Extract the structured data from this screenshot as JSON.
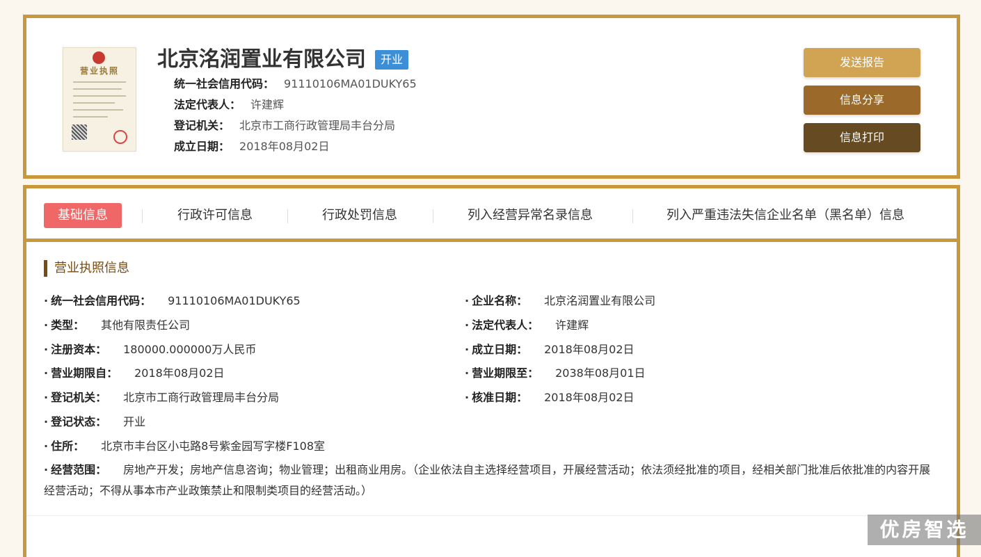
{
  "header": {
    "company_name": "北京洺润置业有限公司",
    "status_tag": "开业",
    "license_thumb_title": "营业执照",
    "credit_code_label": "统一社会信用代码：",
    "credit_code": "91110106MA01DUKY65",
    "legal_rep_label": "法定代表人：",
    "legal_rep": "许建辉",
    "authority_label": "登记机关：",
    "authority": "北京市工商行政管理局丰台分局",
    "founded_label": "成立日期：",
    "founded": "2018年08月02日"
  },
  "actions": {
    "report": "发送报告",
    "share": "信息分享",
    "print": "信息打印"
  },
  "tabs": [
    {
      "label": "基础信息",
      "active": true
    },
    {
      "label": "行政许可信息",
      "active": false
    },
    {
      "label": "行政处罚信息",
      "active": false
    },
    {
      "label": "列入经营异常名录信息",
      "active": false
    },
    {
      "label": "列入严重违法失信企业名单（黑名单）信息",
      "active": false
    }
  ],
  "section": {
    "title": "营业执照信息",
    "fields_left": [
      {
        "label": "统一社会信用代码：",
        "value": "91110106MA01DUKY65"
      },
      {
        "label": "类型：",
        "value": "其他有限责任公司"
      },
      {
        "label": "注册资本：",
        "value": "180000.000000万人民币"
      },
      {
        "label": "营业期限自：",
        "value": "2018年08月02日"
      },
      {
        "label": "登记机关：",
        "value": "北京市工商行政管理局丰台分局"
      },
      {
        "label": "登记状态：",
        "value": "开业"
      },
      {
        "label": "住所：",
        "value": "北京市丰台区小屯路8号紫金园写字楼F108室"
      }
    ],
    "fields_right": [
      {
        "label": "企业名称：",
        "value": "北京洺润置业有限公司"
      },
      {
        "label": "法定代表人：",
        "value": "许建辉"
      },
      {
        "label": "成立日期：",
        "value": "2018年08月02日"
      },
      {
        "label": "营业期限至：",
        "value": "2038年08月01日"
      },
      {
        "label": "核准日期：",
        "value": "2018年08月02日"
      }
    ],
    "scope_label": "经营范围：",
    "scope_value": "房地产开发；房地产信息咨询；物业管理；出租商业用房。（企业依法自主选择经营项目，开展经营活动；依法须经批准的项目，经相关部门批准后依批准的内容开展经营活动；不得从事本市产业政策禁止和限制类项目的经营活动。）"
  },
  "watermark": "优房智选"
}
